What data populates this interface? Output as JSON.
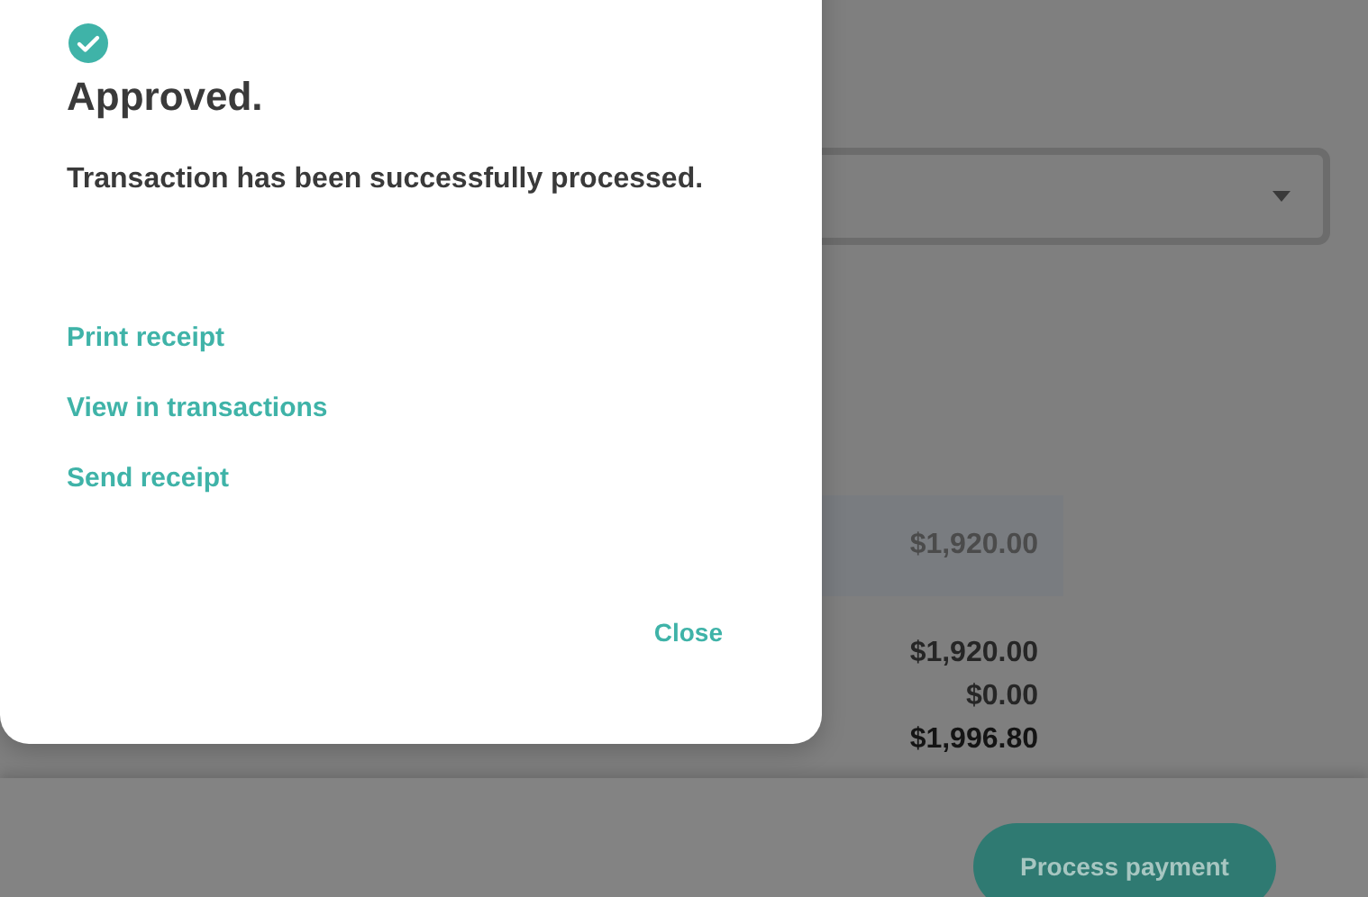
{
  "modal": {
    "kind": "success",
    "title": "Approved.",
    "message": "Transaction has been successfully processed.",
    "actions": [
      {
        "label": "Print receipt"
      },
      {
        "label": "View in transactions"
      },
      {
        "label": "Send receipt"
      }
    ],
    "close_label": "Close"
  },
  "background": {
    "line_item": {
      "amount": "$1,920.00"
    },
    "totals": [
      {
        "value": "$1,920.00",
        "bold": false
      },
      {
        "value": "$0.00",
        "bold": false
      },
      {
        "value": "$1,996.80",
        "bold": true
      }
    ],
    "primary_button": "Process payment"
  }
}
